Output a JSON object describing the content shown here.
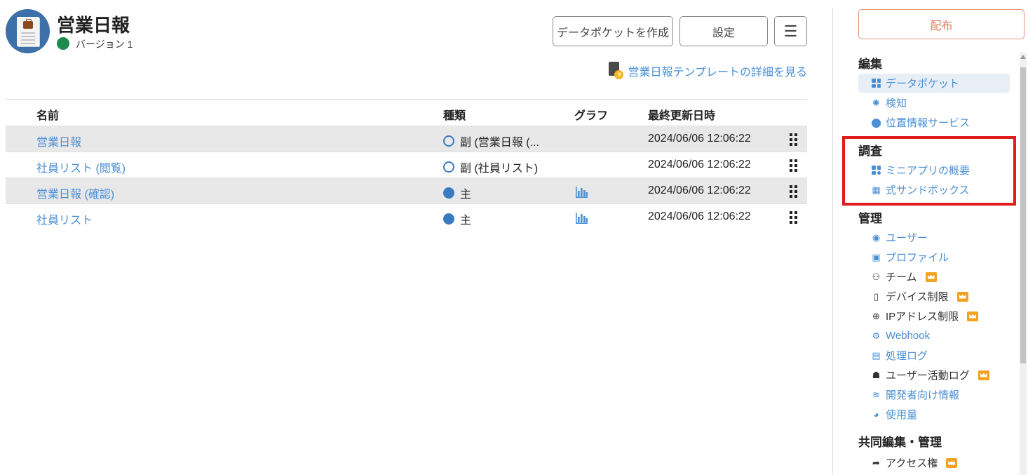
{
  "app": {
    "title": "営業日報",
    "version": "バージョン 1"
  },
  "header": {
    "create_button": "データポケットを作成",
    "settings_button": "設定",
    "menu_button": "☰",
    "template_link": "営業日報テンプレートの詳細を見る"
  },
  "table": {
    "headers": {
      "name": "名前",
      "kind": "種類",
      "graph": "グラフ",
      "updated": "最終更新日時"
    },
    "rows": [
      {
        "name": "営業日報",
        "kind": "副 (営業日報 (...",
        "filled": false,
        "graph": false,
        "updated": "2024/06/06 12:06:22"
      },
      {
        "name": "社員リスト (閲覧)",
        "kind": "副 (社員リスト)",
        "filled": false,
        "graph": false,
        "updated": "2024/06/06 12:06:22"
      },
      {
        "name": "営業日報 (確認)",
        "kind": "主",
        "filled": true,
        "graph": true,
        "updated": "2024/06/06 12:06:22"
      },
      {
        "name": "社員リスト",
        "kind": "主",
        "filled": true,
        "graph": true,
        "updated": "2024/06/06 12:06:22"
      }
    ]
  },
  "sidebar": {
    "publish": "配布",
    "sections": {
      "edit": "編集",
      "investigate": "調査",
      "manage": "管理",
      "shared": "共同編集・管理"
    },
    "edit_items": [
      "データポケット",
      "検知",
      "位置情報サービス"
    ],
    "investigate_items": [
      "ミニアプリの概要",
      "式サンドボックス"
    ],
    "manage_items": [
      "ユーザー",
      "プロファイル",
      "チーム",
      "デバイス制限",
      "IPアドレス制限",
      "Webhook",
      "処理ログ",
      "ユーザー活動ログ",
      "開発者向け情報",
      "使用量"
    ],
    "shared_items": [
      "アクセス権"
    ]
  },
  "colors": {
    "link": "#4a8fd6",
    "highlight": "#e01c1c",
    "publish": "#e27a5e",
    "premium": "#f2a21c",
    "version_dot": "#1e8a4e"
  }
}
